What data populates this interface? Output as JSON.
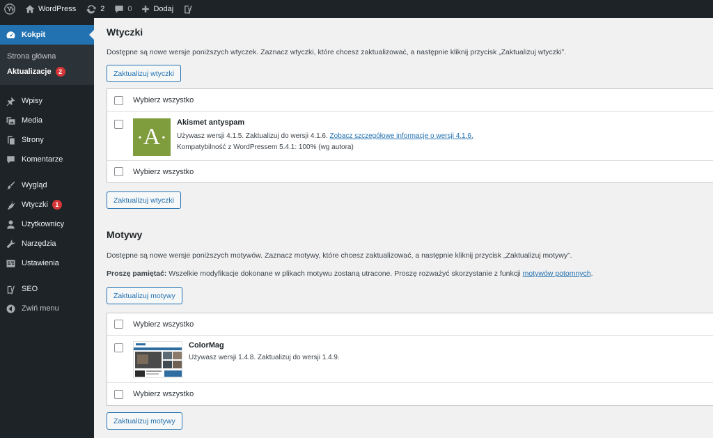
{
  "adminbar": {
    "site_name": "WordPress",
    "updates_count": "2",
    "comments_count": "0",
    "new_label": "Dodaj"
  },
  "sidebar": {
    "dashboard_label": "Kokpit",
    "submenu": {
      "home_label": "Strona główna",
      "updates_label": "Aktualizacje",
      "updates_badge": "2"
    },
    "items": [
      {
        "label": "Wpisy",
        "icon": "pin-icon"
      },
      {
        "label": "Media",
        "icon": "media-icon"
      },
      {
        "label": "Strony",
        "icon": "page-icon"
      },
      {
        "label": "Komentarze",
        "icon": "comment-icon"
      },
      {
        "label": "Wygląd",
        "icon": "brush-icon"
      },
      {
        "label": "Wtyczki",
        "icon": "plugin-icon",
        "badge": "1"
      },
      {
        "label": "Użytkownicy",
        "icon": "user-icon"
      },
      {
        "label": "Narzędzia",
        "icon": "wrench-icon"
      },
      {
        "label": "Ustawienia",
        "icon": "settings-icon"
      },
      {
        "label": "SEO",
        "icon": "yoast-icon"
      },
      {
        "label": "Zwiń menu",
        "icon": "collapse-icon"
      }
    ]
  },
  "plugins": {
    "heading": "Wtyczki",
    "description": "Dostępne są nowe wersje poniższych wtyczek. Zaznacz wtyczki, które chcesz zaktualizować, a następnie kliknij przycisk „Zaktualizuj wtyczki”.",
    "update_button": "Zaktualizuj wtyczki",
    "select_all": "Wybierz wszystko",
    "item": {
      "name": "Akismet antyspam",
      "thumb_letter": "A",
      "version_text": "Używasz wersji 4.1.5. Zaktualizuj do wersji 4.1.6.",
      "details_link": "Zobacz szczegółowe informacje o wersji 4.1.6.",
      "compat": "Kompatybilność z WordPressem 5.4.1: 100% (wg autora)"
    }
  },
  "themes": {
    "heading": "Motywy",
    "description": "Dostępne są nowe wersje poniższych motywów. Zaznacz motywy, które chcesz zaktualizować, a następnie kliknij przycisk „Zaktualizuj motywy”.",
    "notice_bold": "Proszę pamiętać:",
    "notice_text": "Wszelkie modyfikacje dokonane w plikach motywu zostaną utracone. Proszę rozważyć skorzystanie z funkcji",
    "notice_link": "motywów potomnych",
    "notice_end": ".",
    "update_button": "Zaktualizuj motywy",
    "select_all": "Wybierz wszystko",
    "item": {
      "name": "ColorMag",
      "version_text": "Używasz wersji 1.4.8. Zaktualizuj do wersji 1.4.9."
    }
  }
}
